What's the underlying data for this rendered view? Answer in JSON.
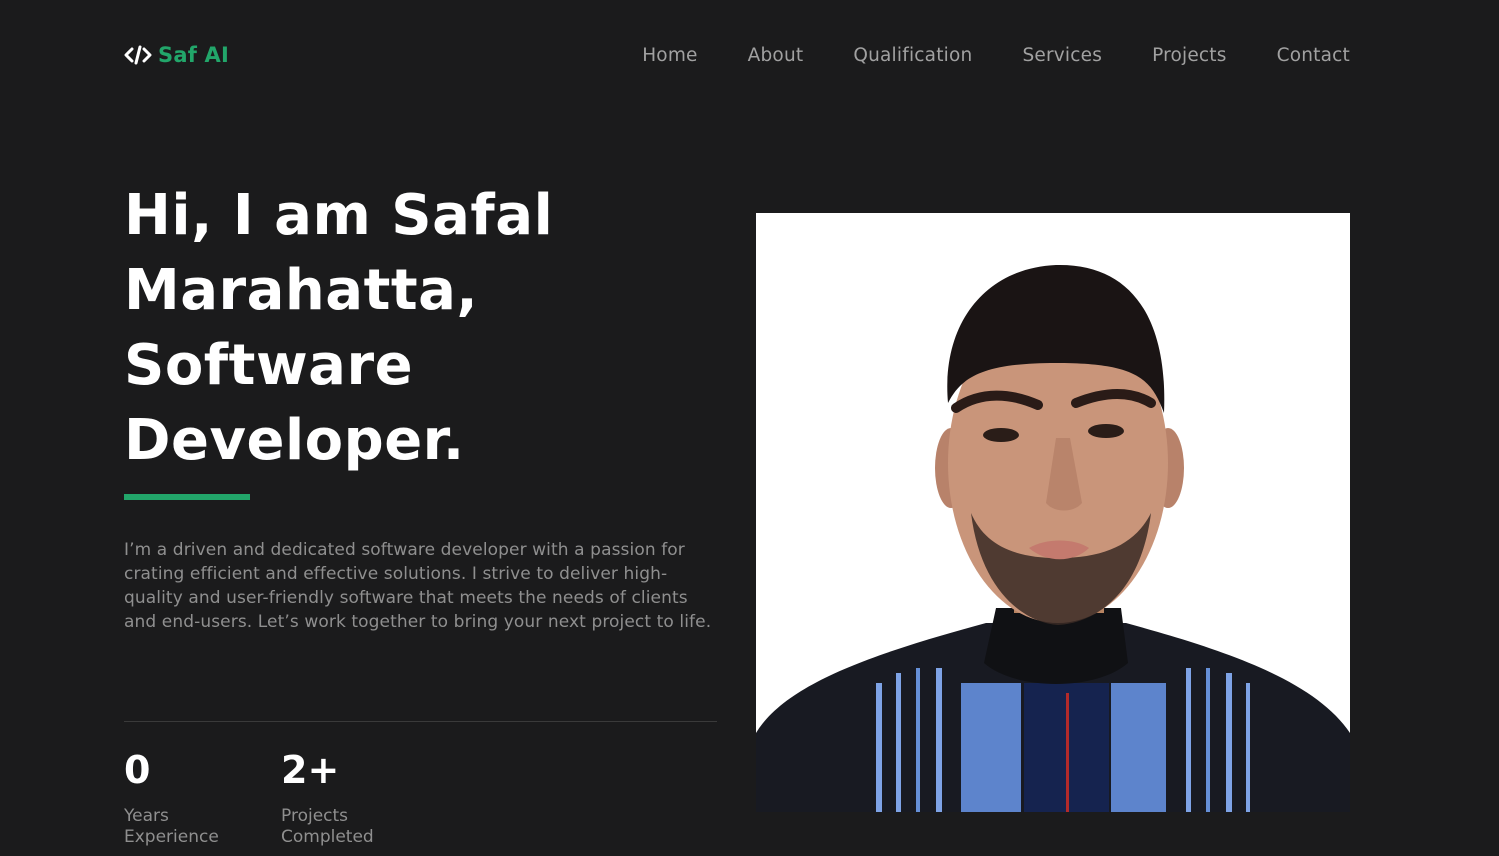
{
  "header": {
    "logo_text": "Saf AI",
    "logo_icon": "code-icon",
    "nav": [
      {
        "label": "Home"
      },
      {
        "label": "About"
      },
      {
        "label": "Qualification"
      },
      {
        "label": "Services"
      },
      {
        "label": "Projects"
      },
      {
        "label": "Contact"
      }
    ]
  },
  "hero": {
    "title_line1": "Hi, I am Safal",
    "title_line2": "Marahatta,",
    "title_line3": "Software",
    "title_line4": "Developer.",
    "description": "I’m a driven and dedicated software developer with a passion for crating efficient and effective solutions. I strive to deliver high-quality and user-friendly software that meets the needs of clients and end-users. Let’s work together to bring your next project to life."
  },
  "stats": [
    {
      "value": "0",
      "label": "Years Experience"
    },
    {
      "value": "2+",
      "label": "Projects Completed"
    }
  ],
  "colors": {
    "background": "#1b1b1c",
    "accent": "#22a66a",
    "nav_text": "#a1a1a1",
    "body_text": "#8f8f8f"
  }
}
